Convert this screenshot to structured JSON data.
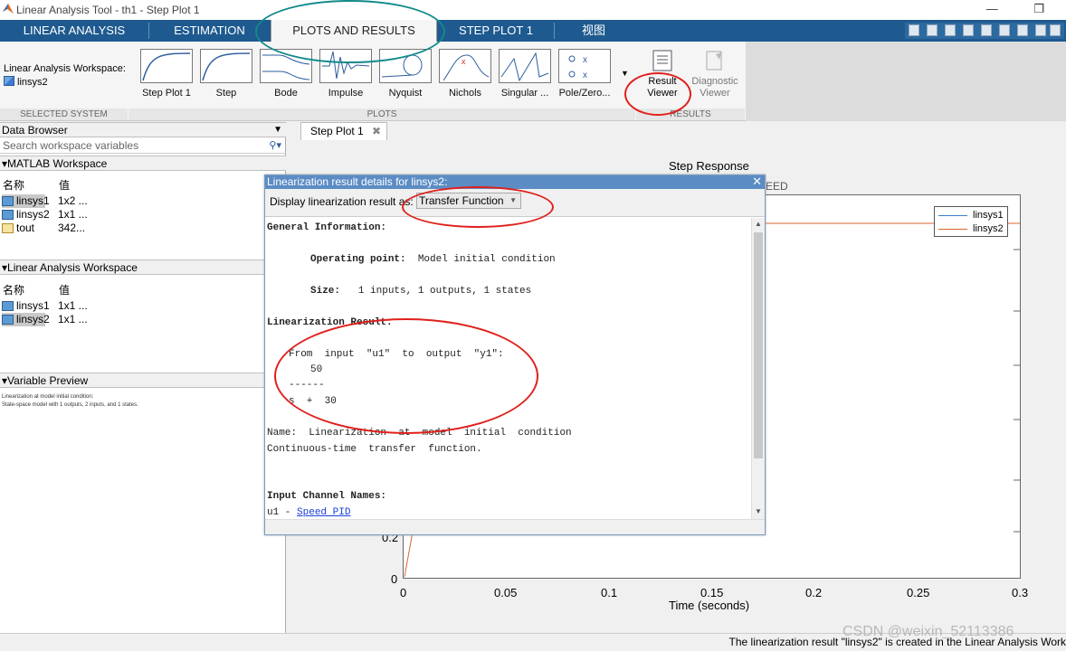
{
  "window": {
    "title": "Linear Analysis Tool - th1 - Step Plot 1",
    "controls": "— ❒"
  },
  "tabs": [
    "LINEAR ANALYSIS",
    "ESTIMATION",
    "PLOTS AND RESULTS",
    "STEP PLOT 1",
    "视图"
  ],
  "active_tab": "PLOTS AND RESULTS",
  "ribbon": {
    "workspace_label": "Linear Analysis Workspace:",
    "workspace_item": "linsys2",
    "plots": [
      "Step Plot 1",
      "Step",
      "Bode",
      "Impulse",
      "Nyquist",
      "Nichols",
      "Singular ...",
      "Pole/Zero..."
    ],
    "result_viewer": [
      "Result",
      "Viewer"
    ],
    "diagnostic_viewer": [
      "Diagnostic",
      "Viewer"
    ],
    "groups": {
      "selected_system": "SELECTED SYSTEM",
      "plots": "PLOTS",
      "results": "RESULTS"
    }
  },
  "data_browser": {
    "title": "Data Browser",
    "search_placeholder": "Search workspace variables",
    "col_name": "名称",
    "col_value": "值",
    "matlab_workspace": {
      "title": "MATLAB Workspace",
      "rows": [
        {
          "name": "linsys1",
          "value": "1x2 ..."
        },
        {
          "name": "linsys2",
          "value": "1x1 ..."
        },
        {
          "name": "tout",
          "value": "342..."
        }
      ]
    },
    "linear_workspace": {
      "title": "Linear Analysis Workspace",
      "rows": [
        {
          "name": "linsys1",
          "value": "1x1 ..."
        },
        {
          "name": "linsys2",
          "value": "1x1 ..."
        }
      ]
    },
    "variable_preview": {
      "title": "Variable Preview",
      "line1": "Linearization at model initial condition:",
      "line2": "State-space model with 1 outputs, 2 inputs, and 1 states."
    }
  },
  "doc_tab": {
    "label": "Step Plot 1",
    "close": "✖"
  },
  "chart_data": {
    "type": "line",
    "title": "Step Response",
    "xlabel": "Time (seconds)",
    "ylabel": "",
    "xlim": [
      0,
      0.3
    ],
    "x_ticks": [
      "0",
      "0.05",
      "0.1",
      "0.15",
      "0.2",
      "0.25",
      "0.3"
    ],
    "y_ticks_visible": [
      "0",
      "0.2"
    ],
    "series": [
      {
        "name": "linsys1",
        "color": "#3a7fc2"
      },
      {
        "name": "linsys2",
        "color": "#d9662c"
      }
    ],
    "partial_text": "EED"
  },
  "dialog": {
    "title": "Linearization result details for linsys2:",
    "display_label": "Display linearization result as:",
    "display_value": "Transfer Function",
    "general_info": "General Information:",
    "op_label": "Operating point:",
    "op_value": "Model initial condition",
    "size_label": "Size:",
    "size_value": "1 inputs, 1 outputs, 1 states",
    "result_heading": "Linearization Result:",
    "tf_from": "From  input  \"u1\"  to  output  \"y1\":",
    "tf_num": "50",
    "tf_bar": "------",
    "tf_den": "s  +  30",
    "name_line": "Name:  Linearization  at  model  initial  condition",
    "tf_type": "Continuous-time  transfer  function.",
    "input_names_heading": "Input Channel Names:",
    "input_channel": "u1 - ",
    "input_link": "Speed PID"
  },
  "status": "The linearization result \"linsys2\" is created in the Linear Analysis Work",
  "watermark": "CSDN @weixin_52113386"
}
